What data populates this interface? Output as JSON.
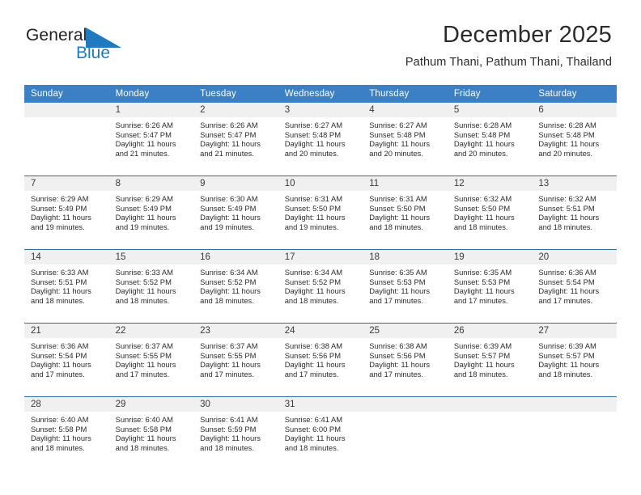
{
  "brand": {
    "name_top": "General",
    "name_bottom": "Blue",
    "accent_color": "#1f7ac0",
    "triangle_icon": "blue-triangle-logo-icon"
  },
  "header": {
    "title": "December 2025",
    "subtitle": "Pathum Thani, Pathum Thani, Thailand"
  },
  "calendar": {
    "header_bg": "#3b7fc4",
    "daynum_bg": "#f0f0f0",
    "row_divider_color": "#2e6da4",
    "weekdays": [
      "Sunday",
      "Monday",
      "Tuesday",
      "Wednesday",
      "Thursday",
      "Friday",
      "Saturday"
    ],
    "weeks": [
      [
        {
          "day": "",
          "blank": true
        },
        {
          "day": "1",
          "sunrise": "Sunrise: 6:26 AM",
          "sunset": "Sunset: 5:47 PM",
          "daylight_1": "Daylight: 11 hours",
          "daylight_2": "and 21 minutes."
        },
        {
          "day": "2",
          "sunrise": "Sunrise: 6:26 AM",
          "sunset": "Sunset: 5:47 PM",
          "daylight_1": "Daylight: 11 hours",
          "daylight_2": "and 21 minutes."
        },
        {
          "day": "3",
          "sunrise": "Sunrise: 6:27 AM",
          "sunset": "Sunset: 5:48 PM",
          "daylight_1": "Daylight: 11 hours",
          "daylight_2": "and 20 minutes."
        },
        {
          "day": "4",
          "sunrise": "Sunrise: 6:27 AM",
          "sunset": "Sunset: 5:48 PM",
          "daylight_1": "Daylight: 11 hours",
          "daylight_2": "and 20 minutes."
        },
        {
          "day": "5",
          "sunrise": "Sunrise: 6:28 AM",
          "sunset": "Sunset: 5:48 PM",
          "daylight_1": "Daylight: 11 hours",
          "daylight_2": "and 20 minutes."
        },
        {
          "day": "6",
          "sunrise": "Sunrise: 6:28 AM",
          "sunset": "Sunset: 5:48 PM",
          "daylight_1": "Daylight: 11 hours",
          "daylight_2": "and 20 minutes."
        }
      ],
      [
        {
          "day": "7",
          "sunrise": "Sunrise: 6:29 AM",
          "sunset": "Sunset: 5:49 PM",
          "daylight_1": "Daylight: 11 hours",
          "daylight_2": "and 19 minutes."
        },
        {
          "day": "8",
          "sunrise": "Sunrise: 6:29 AM",
          "sunset": "Sunset: 5:49 PM",
          "daylight_1": "Daylight: 11 hours",
          "daylight_2": "and 19 minutes."
        },
        {
          "day": "9",
          "sunrise": "Sunrise: 6:30 AM",
          "sunset": "Sunset: 5:49 PM",
          "daylight_1": "Daylight: 11 hours",
          "daylight_2": "and 19 minutes."
        },
        {
          "day": "10",
          "sunrise": "Sunrise: 6:31 AM",
          "sunset": "Sunset: 5:50 PM",
          "daylight_1": "Daylight: 11 hours",
          "daylight_2": "and 19 minutes."
        },
        {
          "day": "11",
          "sunrise": "Sunrise: 6:31 AM",
          "sunset": "Sunset: 5:50 PM",
          "daylight_1": "Daylight: 11 hours",
          "daylight_2": "and 18 minutes."
        },
        {
          "day": "12",
          "sunrise": "Sunrise: 6:32 AM",
          "sunset": "Sunset: 5:50 PM",
          "daylight_1": "Daylight: 11 hours",
          "daylight_2": "and 18 minutes."
        },
        {
          "day": "13",
          "sunrise": "Sunrise: 6:32 AM",
          "sunset": "Sunset: 5:51 PM",
          "daylight_1": "Daylight: 11 hours",
          "daylight_2": "and 18 minutes."
        }
      ],
      [
        {
          "day": "14",
          "sunrise": "Sunrise: 6:33 AM",
          "sunset": "Sunset: 5:51 PM",
          "daylight_1": "Daylight: 11 hours",
          "daylight_2": "and 18 minutes."
        },
        {
          "day": "15",
          "sunrise": "Sunrise: 6:33 AM",
          "sunset": "Sunset: 5:52 PM",
          "daylight_1": "Daylight: 11 hours",
          "daylight_2": "and 18 minutes."
        },
        {
          "day": "16",
          "sunrise": "Sunrise: 6:34 AM",
          "sunset": "Sunset: 5:52 PM",
          "daylight_1": "Daylight: 11 hours",
          "daylight_2": "and 18 minutes."
        },
        {
          "day": "17",
          "sunrise": "Sunrise: 6:34 AM",
          "sunset": "Sunset: 5:52 PM",
          "daylight_1": "Daylight: 11 hours",
          "daylight_2": "and 18 minutes."
        },
        {
          "day": "18",
          "sunrise": "Sunrise: 6:35 AM",
          "sunset": "Sunset: 5:53 PM",
          "daylight_1": "Daylight: 11 hours",
          "daylight_2": "and 17 minutes."
        },
        {
          "day": "19",
          "sunrise": "Sunrise: 6:35 AM",
          "sunset": "Sunset: 5:53 PM",
          "daylight_1": "Daylight: 11 hours",
          "daylight_2": "and 17 minutes."
        },
        {
          "day": "20",
          "sunrise": "Sunrise: 6:36 AM",
          "sunset": "Sunset: 5:54 PM",
          "daylight_1": "Daylight: 11 hours",
          "daylight_2": "and 17 minutes."
        }
      ],
      [
        {
          "day": "21",
          "sunrise": "Sunrise: 6:36 AM",
          "sunset": "Sunset: 5:54 PM",
          "daylight_1": "Daylight: 11 hours",
          "daylight_2": "and 17 minutes."
        },
        {
          "day": "22",
          "sunrise": "Sunrise: 6:37 AM",
          "sunset": "Sunset: 5:55 PM",
          "daylight_1": "Daylight: 11 hours",
          "daylight_2": "and 17 minutes."
        },
        {
          "day": "23",
          "sunrise": "Sunrise: 6:37 AM",
          "sunset": "Sunset: 5:55 PM",
          "daylight_1": "Daylight: 11 hours",
          "daylight_2": "and 17 minutes."
        },
        {
          "day": "24",
          "sunrise": "Sunrise: 6:38 AM",
          "sunset": "Sunset: 5:56 PM",
          "daylight_1": "Daylight: 11 hours",
          "daylight_2": "and 17 minutes."
        },
        {
          "day": "25",
          "sunrise": "Sunrise: 6:38 AM",
          "sunset": "Sunset: 5:56 PM",
          "daylight_1": "Daylight: 11 hours",
          "daylight_2": "and 17 minutes."
        },
        {
          "day": "26",
          "sunrise": "Sunrise: 6:39 AM",
          "sunset": "Sunset: 5:57 PM",
          "daylight_1": "Daylight: 11 hours",
          "daylight_2": "and 18 minutes."
        },
        {
          "day": "27",
          "sunrise": "Sunrise: 6:39 AM",
          "sunset": "Sunset: 5:57 PM",
          "daylight_1": "Daylight: 11 hours",
          "daylight_2": "and 18 minutes."
        }
      ],
      [
        {
          "day": "28",
          "sunrise": "Sunrise: 6:40 AM",
          "sunset": "Sunset: 5:58 PM",
          "daylight_1": "Daylight: 11 hours",
          "daylight_2": "and 18 minutes."
        },
        {
          "day": "29",
          "sunrise": "Sunrise: 6:40 AM",
          "sunset": "Sunset: 5:58 PM",
          "daylight_1": "Daylight: 11 hours",
          "daylight_2": "and 18 minutes."
        },
        {
          "day": "30",
          "sunrise": "Sunrise: 6:41 AM",
          "sunset": "Sunset: 5:59 PM",
          "daylight_1": "Daylight: 11 hours",
          "daylight_2": "and 18 minutes."
        },
        {
          "day": "31",
          "sunrise": "Sunrise: 6:41 AM",
          "sunset": "Sunset: 6:00 PM",
          "daylight_1": "Daylight: 11 hours",
          "daylight_2": "and 18 minutes."
        },
        {
          "day": "",
          "blank": true
        },
        {
          "day": "",
          "blank": true
        },
        {
          "day": "",
          "blank": true
        }
      ]
    ]
  }
}
